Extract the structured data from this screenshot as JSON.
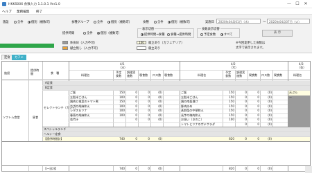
{
  "window": {
    "title": "HKKS006 食数入力 1.1.0.1 Ver1.0",
    "controls": [
      "—",
      "☐",
      "✕"
    ]
  },
  "menu": [
    "ヘルプ",
    "業務編集",
    "終了"
  ],
  "filters": {
    "shisetsu": {
      "label": "施設",
      "options": [
        "全件",
        "個別（複数可）"
      ],
      "selected": 1
    },
    "shokushu_group": {
      "label": "食種グループ",
      "options": [
        "全件",
        "個別（複数可）"
      ],
      "selected": 1
    },
    "shokushu": {
      "label": "食種",
      "options": [
        "全件",
        "個別（複数可）"
      ],
      "selected": 1
    },
    "jisshibi": {
      "label": "実施日",
      "from": "2020年04月01日（水）",
      "tilde": "～",
      "to": "2020年04月07日（火）"
    },
    "teikyo_jikan": {
      "label": "提供時間",
      "options": [
        "全件",
        "個別（複数可）"
      ],
      "selected": 1
    },
    "hyoji_kirikae": {
      "label": "表示切替",
      "options": [
        "提供時間→食種",
        "食種→提供時間"
      ],
      "selected": 0
    },
    "shokusu_hyoji": {
      "label": "食数表示切替",
      "options": [
        "予定食数",
        "すべて"
      ],
      "selected": 1
    },
    "show_button": "表 示"
  },
  "legend": {
    "kyuushoku": "休食日（入力不可）",
    "kondate_nashi": "献立無し（入力不可）",
    "kondate_ari": "献立あり（カフェテリア）",
    "value_100": "100",
    "kondate_ari_2": "献立あり"
  },
  "note": {
    "line1": "※今回変更した食数は",
    "line2": "太字で表示されます。"
  },
  "tabs": [
    "定食",
    "カフェ"
  ],
  "colors": {
    "accent_green": "#2fa64a",
    "tab_active": "#3fb0c8",
    "legend_gray": "#9a9a9a",
    "legend_orange": "#e8a23a",
    "legend_yellow": "#fffde0"
  },
  "grid": {
    "left_headers": [
      "施設",
      "提供時間",
      "食　種"
    ],
    "days": [
      {
        "date": "4/1",
        "dow": "（水）"
      },
      {
        "date": "4/2",
        "dow": "（木）"
      },
      {
        "date": "4/3",
        "dow": "（金）"
      }
    ],
    "sub_headers": [
      "料理名",
      "予定食数",
      "調理実施数",
      "喫食数",
      "ロス数",
      "喫食数"
    ],
    "facility": "ソフトム食堂",
    "time": "昼食",
    "teishoku_rows": [
      "A定食",
      "B定食"
    ],
    "select_label": "セレクトランチ（カフェ）",
    "menu_rows": [
      {
        "d1": "ご飯",
        "v1": "150",
        "e1": "0",
        "f1": "0",
        "g1": "(0)",
        "d2": "ご飯",
        "v2": "150",
        "e2": "0",
        "f2": "0",
        "g2": "(0)",
        "d3": "天ぷら"
      },
      {
        "d1": "五穀米ごはん",
        "v1": "100",
        "e1": "0",
        "f1": "0",
        "g1": "(0)",
        "d2": "五穀米ごはん",
        "v2": "150",
        "e2": "0",
        "f2": "0",
        "g2": "(0)",
        "d3": "ー"
      },
      {
        "d1": "鶏肉と根菜のトマト煮",
        "v1": "150",
        "e1": "0",
        "f1": "0",
        "g1": "(0)",
        "d2": "鶏の南蛮漬け",
        "v2": "150",
        "e2": "0",
        "f2": "0",
        "g2": "(0)",
        "d3": ""
      },
      {
        "d1": "カボの胡麻和え",
        "v1": "100",
        "e1": "0",
        "f1": "0",
        "g1": "(0)",
        "d2": "豚肉炒め",
        "v2": "150",
        "e2": "0",
        "f2": "0",
        "g2": "(0)",
        "d3": ""
      },
      {
        "d1": "レタス＆ツナ",
        "v1": "100",
        "e1": "0",
        "f1": "0",
        "g1": "(0)",
        "d2": "蒸野菜の中華和え",
        "v2": "150",
        "e2": "0",
        "f2": "0",
        "g2": "(0)",
        "d3": ""
      },
      {
        "d1": "春菊の胡麻和え",
        "v1": "100",
        "e1": "0",
        "f1": "0",
        "g1": "(0)",
        "d2": "長芋の梅肉和え",
        "v2": "150",
        "e2": "0",
        "f2": "0",
        "g2": "(0)",
        "d3": ""
      },
      {
        "d1": "若竹汁",
        "v1": "",
        "e1": "0",
        "f1": "0",
        "g1": "(0)",
        "d2": "お吸い（きのこ）",
        "v2": "100",
        "e2": "0",
        "f2": "0",
        "g2": "(0)",
        "d3": ""
      },
      {
        "d1": "",
        "v1": "",
        "e1": "",
        "f1": "",
        "g1": "",
        "d2": "トマトとツナのポテサラダ",
        "v2": "",
        "e2": "0",
        "f2": "0",
        "g2": "(0)",
        "d3": ""
      }
    ],
    "extra_rows": [
      "スペシャルランチ",
      "ヘルシー定食",
      "【提供時間計】"
    ],
    "subtotal": {
      "v1": "740",
      "e1": "0",
      "f1": "0",
      "g1": "(0)",
      "v2": "820",
      "e2": "0",
      "f2": "0",
      "g2": "(0)"
    },
    "total_label": "【一日計】",
    "total": {
      "v1": "740",
      "e1": "0",
      "f1": "0",
      "g1": "(0)",
      "v2": "820",
      "e2": "0",
      "f2": "0",
      "g2": "(0)"
    }
  }
}
